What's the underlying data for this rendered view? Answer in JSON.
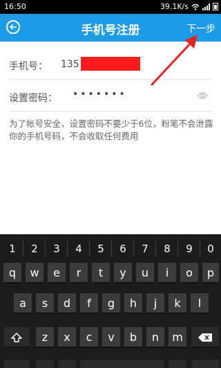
{
  "status_bar": {
    "time": "16:50",
    "speed": "39.1K/s"
  },
  "header": {
    "title": "手机号注册",
    "next_label": "下一步"
  },
  "form": {
    "phone_label": "手机号：",
    "phone_value": "135",
    "password_label": "设置密码：",
    "password_value": "•••••••"
  },
  "note": "为了帐号安全，设置密码不要少于6位，粉笔不会泄露你的手机号码，不会收取任何费用",
  "keyboard": {
    "number_row": [
      "1",
      "2",
      "3",
      "4",
      "5",
      "6",
      "7",
      "8",
      "9",
      "0"
    ],
    "row1": [
      "q",
      "w",
      "e",
      "r",
      "t",
      "y",
      "u",
      "i",
      "o",
      "p"
    ],
    "row2": [
      "a",
      "s",
      "d",
      "f",
      "g",
      "h",
      "j",
      "k",
      "l"
    ],
    "row3": [
      "z",
      "x",
      "c",
      "v",
      "b",
      "n",
      "m"
    ]
  },
  "colors": {
    "accent": "#1e9be6",
    "annotation": "#e32222"
  }
}
